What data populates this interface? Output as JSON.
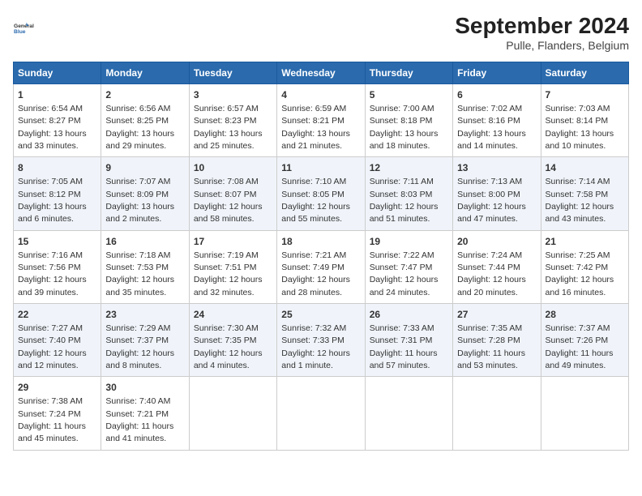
{
  "header": {
    "logo_line1": "General",
    "logo_line2": "Blue",
    "title": "September 2024",
    "subtitle": "Pulle, Flanders, Belgium"
  },
  "days_of_week": [
    "Sunday",
    "Monday",
    "Tuesday",
    "Wednesday",
    "Thursday",
    "Friday",
    "Saturday"
  ],
  "weeks": [
    [
      {
        "day": "1",
        "detail": "Sunrise: 6:54 AM\nSunset: 8:27 PM\nDaylight: 13 hours\nand 33 minutes."
      },
      {
        "day": "2",
        "detail": "Sunrise: 6:56 AM\nSunset: 8:25 PM\nDaylight: 13 hours\nand 29 minutes."
      },
      {
        "day": "3",
        "detail": "Sunrise: 6:57 AM\nSunset: 8:23 PM\nDaylight: 13 hours\nand 25 minutes."
      },
      {
        "day": "4",
        "detail": "Sunrise: 6:59 AM\nSunset: 8:21 PM\nDaylight: 13 hours\nand 21 minutes."
      },
      {
        "day": "5",
        "detail": "Sunrise: 7:00 AM\nSunset: 8:18 PM\nDaylight: 13 hours\nand 18 minutes."
      },
      {
        "day": "6",
        "detail": "Sunrise: 7:02 AM\nSunset: 8:16 PM\nDaylight: 13 hours\nand 14 minutes."
      },
      {
        "day": "7",
        "detail": "Sunrise: 7:03 AM\nSunset: 8:14 PM\nDaylight: 13 hours\nand 10 minutes."
      }
    ],
    [
      {
        "day": "8",
        "detail": "Sunrise: 7:05 AM\nSunset: 8:12 PM\nDaylight: 13 hours\nand 6 minutes."
      },
      {
        "day": "9",
        "detail": "Sunrise: 7:07 AM\nSunset: 8:09 PM\nDaylight: 13 hours\nand 2 minutes."
      },
      {
        "day": "10",
        "detail": "Sunrise: 7:08 AM\nSunset: 8:07 PM\nDaylight: 12 hours\nand 58 minutes."
      },
      {
        "day": "11",
        "detail": "Sunrise: 7:10 AM\nSunset: 8:05 PM\nDaylight: 12 hours\nand 55 minutes."
      },
      {
        "day": "12",
        "detail": "Sunrise: 7:11 AM\nSunset: 8:03 PM\nDaylight: 12 hours\nand 51 minutes."
      },
      {
        "day": "13",
        "detail": "Sunrise: 7:13 AM\nSunset: 8:00 PM\nDaylight: 12 hours\nand 47 minutes."
      },
      {
        "day": "14",
        "detail": "Sunrise: 7:14 AM\nSunset: 7:58 PM\nDaylight: 12 hours\nand 43 minutes."
      }
    ],
    [
      {
        "day": "15",
        "detail": "Sunrise: 7:16 AM\nSunset: 7:56 PM\nDaylight: 12 hours\nand 39 minutes."
      },
      {
        "day": "16",
        "detail": "Sunrise: 7:18 AM\nSunset: 7:53 PM\nDaylight: 12 hours\nand 35 minutes."
      },
      {
        "day": "17",
        "detail": "Sunrise: 7:19 AM\nSunset: 7:51 PM\nDaylight: 12 hours\nand 32 minutes."
      },
      {
        "day": "18",
        "detail": "Sunrise: 7:21 AM\nSunset: 7:49 PM\nDaylight: 12 hours\nand 28 minutes."
      },
      {
        "day": "19",
        "detail": "Sunrise: 7:22 AM\nSunset: 7:47 PM\nDaylight: 12 hours\nand 24 minutes."
      },
      {
        "day": "20",
        "detail": "Sunrise: 7:24 AM\nSunset: 7:44 PM\nDaylight: 12 hours\nand 20 minutes."
      },
      {
        "day": "21",
        "detail": "Sunrise: 7:25 AM\nSunset: 7:42 PM\nDaylight: 12 hours\nand 16 minutes."
      }
    ],
    [
      {
        "day": "22",
        "detail": "Sunrise: 7:27 AM\nSunset: 7:40 PM\nDaylight: 12 hours\nand 12 minutes."
      },
      {
        "day": "23",
        "detail": "Sunrise: 7:29 AM\nSunset: 7:37 PM\nDaylight: 12 hours\nand 8 minutes."
      },
      {
        "day": "24",
        "detail": "Sunrise: 7:30 AM\nSunset: 7:35 PM\nDaylight: 12 hours\nand 4 minutes."
      },
      {
        "day": "25",
        "detail": "Sunrise: 7:32 AM\nSunset: 7:33 PM\nDaylight: 12 hours\nand 1 minute."
      },
      {
        "day": "26",
        "detail": "Sunrise: 7:33 AM\nSunset: 7:31 PM\nDaylight: 11 hours\nand 57 minutes."
      },
      {
        "day": "27",
        "detail": "Sunrise: 7:35 AM\nSunset: 7:28 PM\nDaylight: 11 hours\nand 53 minutes."
      },
      {
        "day": "28",
        "detail": "Sunrise: 7:37 AM\nSunset: 7:26 PM\nDaylight: 11 hours\nand 49 minutes."
      }
    ],
    [
      {
        "day": "29",
        "detail": "Sunrise: 7:38 AM\nSunset: 7:24 PM\nDaylight: 11 hours\nand 45 minutes."
      },
      {
        "day": "30",
        "detail": "Sunrise: 7:40 AM\nSunset: 7:21 PM\nDaylight: 11 hours\nand 41 minutes."
      },
      {
        "day": "",
        "detail": ""
      },
      {
        "day": "",
        "detail": ""
      },
      {
        "day": "",
        "detail": ""
      },
      {
        "day": "",
        "detail": ""
      },
      {
        "day": "",
        "detail": ""
      }
    ]
  ]
}
